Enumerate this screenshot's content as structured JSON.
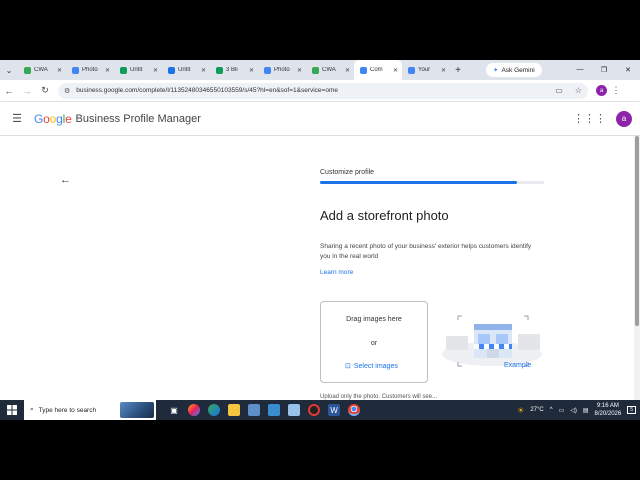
{
  "browser": {
    "tabs": [
      {
        "label": "CWA",
        "color": "#34a853",
        "active": false
      },
      {
        "label": "Photo",
        "color": "#4285f4",
        "active": false
      },
      {
        "label": "Untit",
        "color": "#0f9d58",
        "active": false
      },
      {
        "label": "Untit",
        "color": "#1a73e8",
        "active": false
      },
      {
        "label": "3 Bli",
        "color": "#0f9d58",
        "active": false
      },
      {
        "label": "Photo",
        "color": "#4285f4",
        "active": false
      },
      {
        "label": "CWA",
        "color": "#34a853",
        "active": false
      },
      {
        "label": "Com",
        "color": "#4285f4",
        "active": true
      },
      {
        "label": "Your",
        "color": "#4285f4",
        "active": false
      }
    ],
    "new_tab_label": "+",
    "gemini_label": "Ask Gemini",
    "window_controls": [
      "—",
      "❐",
      "✕"
    ],
    "url": "business.google.com/complete/l/11352480346550103559/s/45?hl=en&sof=1&service=ome",
    "profile_letter": "a"
  },
  "app": {
    "logo_letters": [
      "G",
      "o",
      "o",
      "g",
      "l",
      "e"
    ],
    "title": "Business Profile Manager",
    "avatar_letter": "a"
  },
  "step": {
    "label": "Customize profile",
    "progress_fraction": 0.88
  },
  "main": {
    "headline": "Add a storefront photo",
    "description": "Sharing a recent photo of your business' exterior helps customers identify you in the real world",
    "learn_more": "Learn more",
    "dropzone": {
      "drag_text": "Drag images here",
      "or_text": "or",
      "select_label": "Select images"
    },
    "example_label": "Example",
    "cutoff_text": "Upload only the photo. Customers will see..."
  },
  "taskbar": {
    "search_placeholder": "Type here to search",
    "weather": "27°C",
    "time": "9:16 AM",
    "date": "8/20/2026",
    "notification_count": "5"
  },
  "colors": {
    "accent": "#1a73e8",
    "avatar": "#8e24aa",
    "taskbar": "#1f2a3a"
  }
}
